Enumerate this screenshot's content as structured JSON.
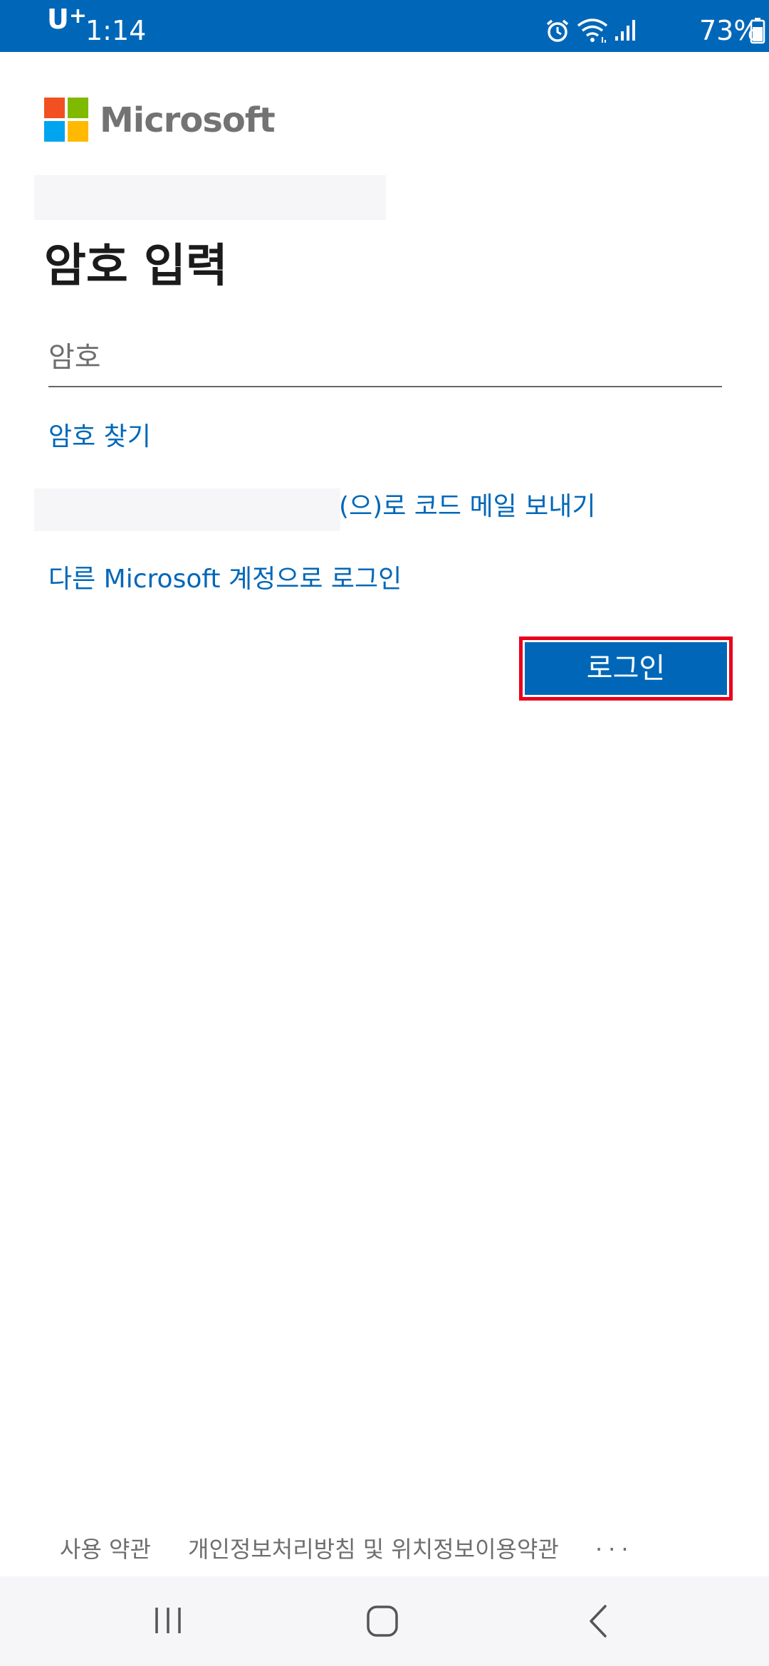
{
  "status_bar": {
    "carrier": "U",
    "carrier_plus": "+",
    "time": "1:14",
    "battery": "73%",
    "icons": [
      "alarm-icon",
      "wifi-icon",
      "signal-icon",
      "battery-icon"
    ]
  },
  "brand": {
    "name": "Microsoft",
    "colors": [
      "#f25022",
      "#7fba00",
      "#00a4ef",
      "#ffb900"
    ]
  },
  "page": {
    "title": "암호 입력",
    "password_placeholder": "암호",
    "forgot_password": "암호 찾기",
    "email_code_suffix": "(으)로 코드 메일 보내기",
    "other_account": "다른 Microsoft 계정으로 로그인",
    "signin_button": "로그인"
  },
  "footer": {
    "terms": "사용 약관",
    "privacy": "개인정보처리방침 및 위치정보이용약관",
    "more": "···"
  },
  "colors": {
    "accent": "#0067b8",
    "highlight": "#e8001c",
    "text": "#1b1b1b"
  },
  "nav_bar": {
    "icons": [
      "recent-apps-icon",
      "home-icon",
      "back-icon"
    ]
  }
}
